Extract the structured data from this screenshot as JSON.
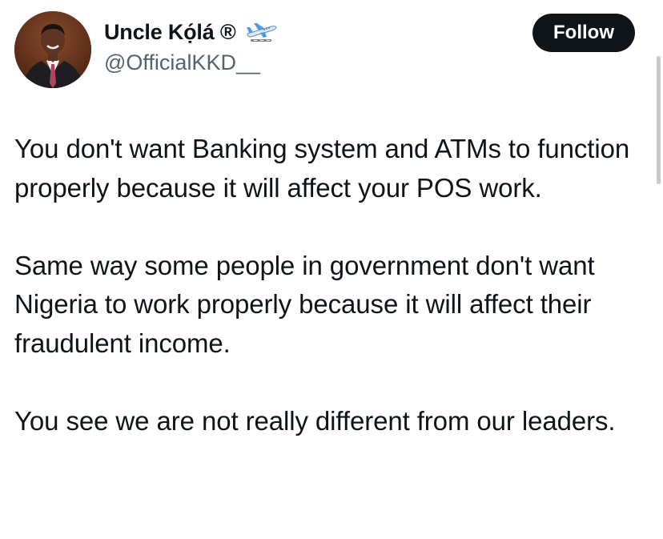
{
  "author": {
    "display_name": "Uncle Kọ́lá ®",
    "handle": "@OfficialKKD__",
    "emoji_icon": "airplane-departure-icon"
  },
  "actions": {
    "follow_label": "Follow"
  },
  "tweet": {
    "paragraphs": [
      "You don't want Banking system and ATMs to function properly because it will affect your POS work.",
      "Same way some people in government don't want Nigeria to work properly because it will affect their fraudulent income.",
      "You see we are not really different from our leaders."
    ]
  },
  "colors": {
    "text": "#0f1419",
    "secondary_text": "#536471",
    "follow_button_bg": "#0f1419",
    "follow_button_text": "#ffffff"
  }
}
